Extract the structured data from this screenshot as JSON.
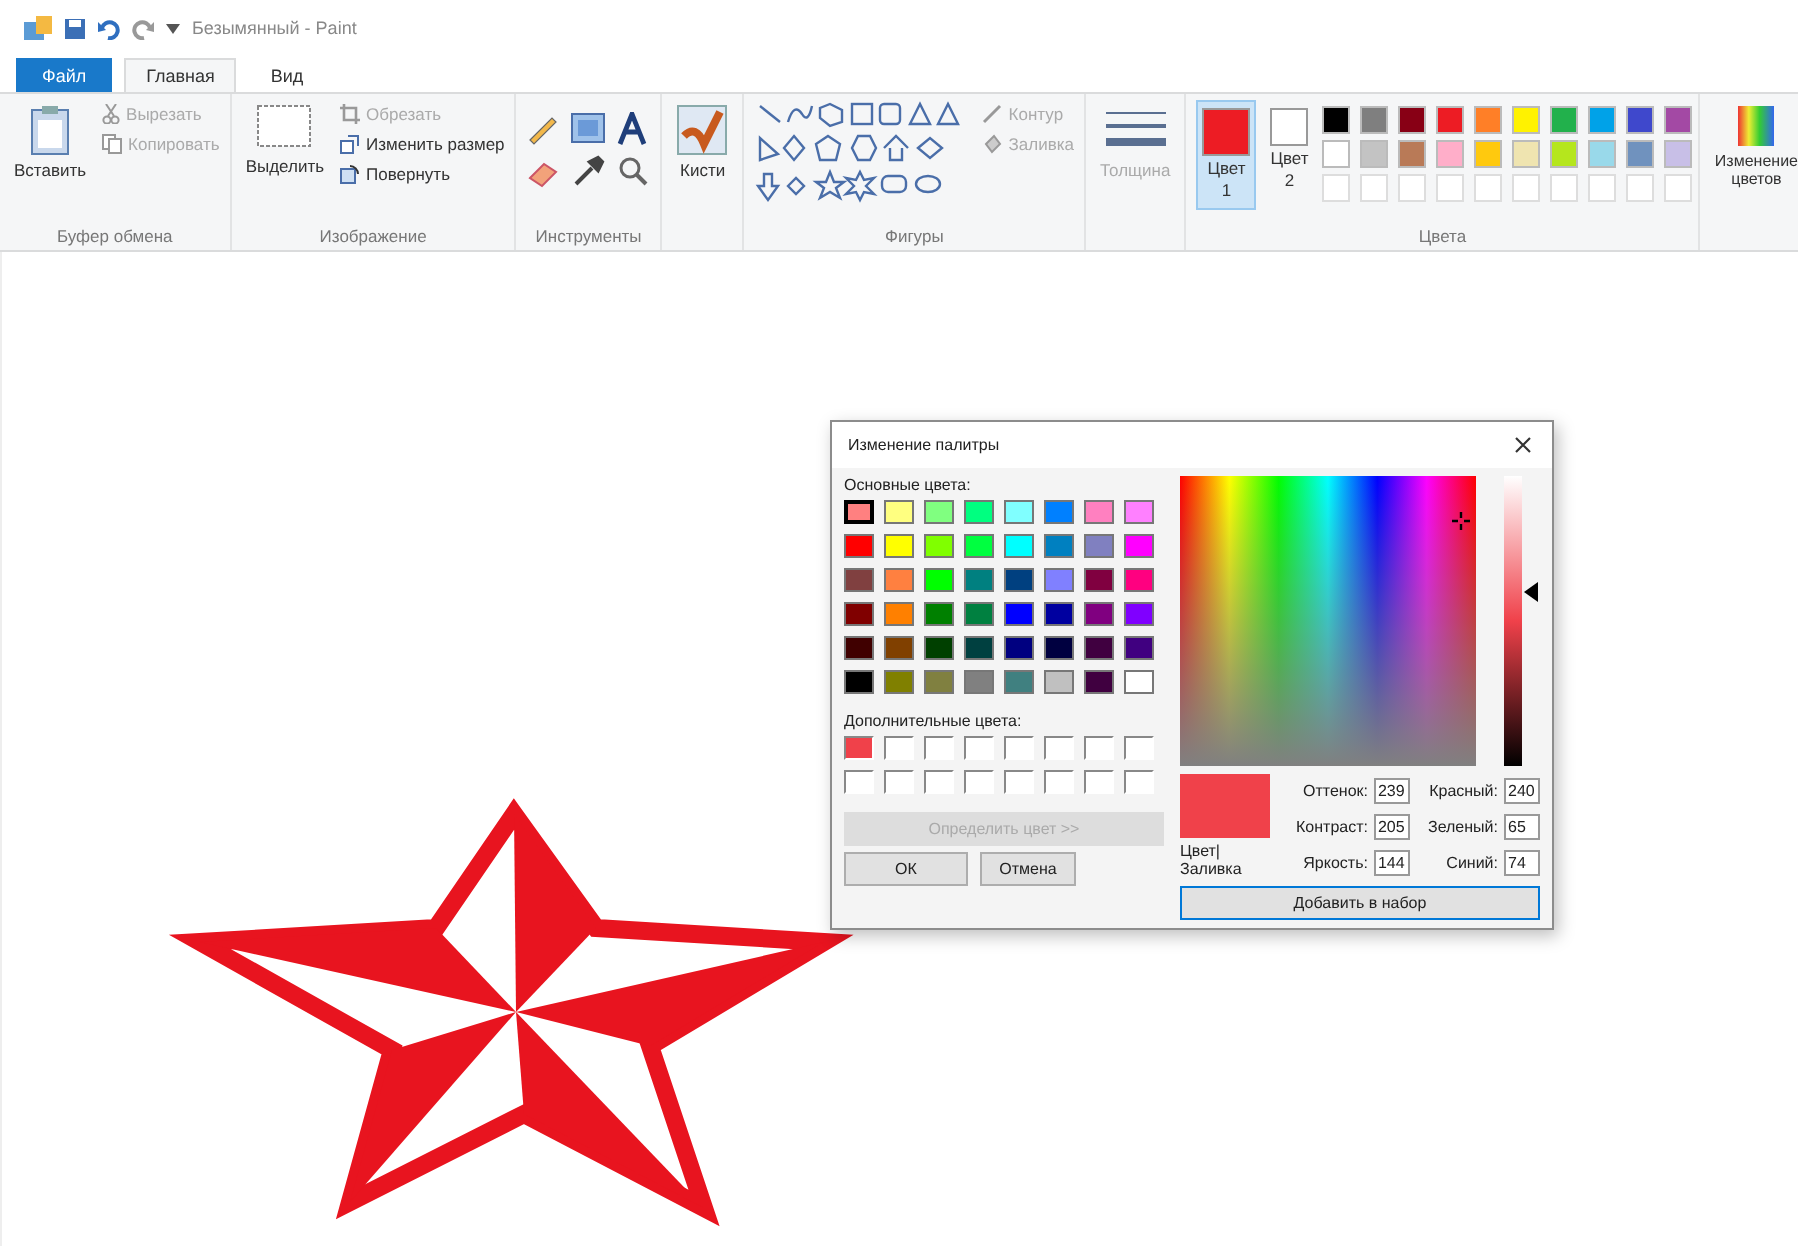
{
  "title_bar": {
    "title": "Безымянный - Paint"
  },
  "tabs": [
    {
      "label": "Файл",
      "kind": "file",
      "selected": false
    },
    {
      "label": "Главная",
      "kind": "tab",
      "selected": true
    },
    {
      "label": "Вид",
      "kind": "tab",
      "selected": false
    }
  ],
  "ribbon": {
    "clipboard": {
      "label": "Буфер обмена",
      "paste": "Вставить",
      "cut": {
        "label": "Вырезать",
        "disabled": true
      },
      "copy": {
        "label": "Копировать",
        "disabled": true
      }
    },
    "image": {
      "label": "Изображение",
      "select": "Выделить",
      "crop": {
        "label": "Обрезать",
        "disabled": true
      },
      "resize": {
        "label": "Изменить размер",
        "disabled": false
      },
      "rotate": {
        "label": "Повернуть",
        "disabled": false
      }
    },
    "tools": {
      "label": "Инструменты"
    },
    "brushes": "Кисти",
    "shapes": {
      "label": "Фигуры",
      "outline": {
        "label": "Контур",
        "disabled": true
      },
      "fill": {
        "label": "Заливка",
        "disabled": true
      }
    },
    "size": {
      "label": "Толщина",
      "disabled": true
    },
    "colors": {
      "label": "Цвета",
      "slots": [
        {
          "label": "Цвет 1",
          "color": "#ed1c24",
          "selected": true
        },
        {
          "label": "Цвет 2",
          "color": "#ffffff",
          "selected": false
        }
      ],
      "palette": [
        {
          "color": "#000000"
        },
        {
          "color": "#7f7f7f"
        },
        {
          "color": "#880015"
        },
        {
          "color": "#ed1c24"
        },
        {
          "color": "#ff7f27"
        },
        {
          "color": "#fff200"
        },
        {
          "color": "#22b14c"
        },
        {
          "color": "#00a2e8"
        },
        {
          "color": "#3f48cc"
        },
        {
          "color": "#a349a4"
        },
        {
          "color": "#ffffff"
        },
        {
          "color": "#c3c3c3"
        },
        {
          "color": "#b97a57"
        },
        {
          "color": "#ffaec9"
        },
        {
          "color": "#ffc90e"
        },
        {
          "color": "#efe4b0"
        },
        {
          "color": "#b5e61d"
        },
        {
          "color": "#99d9ea"
        },
        {
          "color": "#7092be"
        },
        {
          "color": "#c8bfe7"
        }
      ],
      "edit_colors": "Изменение цветов"
    }
  },
  "dialog": {
    "title": "Изменение палитры",
    "basic_label": "Основные цвета:",
    "basic_colors": [
      {
        "color": "#ff8080",
        "selected": true
      },
      {
        "color": "#ffff80",
        "selected": false
      },
      {
        "color": "#80ff80",
        "selected": false
      },
      {
        "color": "#00ff80",
        "selected": false
      },
      {
        "color": "#80ffff",
        "selected": false
      },
      {
        "color": "#0080ff",
        "selected": false
      },
      {
        "color": "#ff80c0",
        "selected": false
      },
      {
        "color": "#ff80ff",
        "selected": false
      },
      {
        "color": "#ff0000",
        "selected": false
      },
      {
        "color": "#ffff00",
        "selected": false
      },
      {
        "color": "#80ff00",
        "selected": false
      },
      {
        "color": "#00ff40",
        "selected": false
      },
      {
        "color": "#00ffff",
        "selected": false
      },
      {
        "color": "#0080c0",
        "selected": false
      },
      {
        "color": "#8080c0",
        "selected": false
      },
      {
        "color": "#ff00ff",
        "selected": false
      },
      {
        "color": "#804040",
        "selected": false
      },
      {
        "color": "#ff8040",
        "selected": false
      },
      {
        "color": "#00ff00",
        "selected": false
      },
      {
        "color": "#008080",
        "selected": false
      },
      {
        "color": "#004080",
        "selected": false
      },
      {
        "color": "#8080ff",
        "selected": false
      },
      {
        "color": "#800040",
        "selected": false
      },
      {
        "color": "#ff0080",
        "selected": false
      },
      {
        "color": "#800000",
        "selected": false
      },
      {
        "color": "#ff8000",
        "selected": false
      },
      {
        "color": "#008000",
        "selected": false
      },
      {
        "color": "#008040",
        "selected": false
      },
      {
        "color": "#0000ff",
        "selected": false
      },
      {
        "color": "#0000a0",
        "selected": false
      },
      {
        "color": "#800080",
        "selected": false
      },
      {
        "color": "#8000ff",
        "selected": false
      },
      {
        "color": "#400000",
        "selected": false
      },
      {
        "color": "#804000",
        "selected": false
      },
      {
        "color": "#004000",
        "selected": false
      },
      {
        "color": "#004040",
        "selected": false
      },
      {
        "color": "#000080",
        "selected": false
      },
      {
        "color": "#000040",
        "selected": false
      },
      {
        "color": "#400040",
        "selected": false
      },
      {
        "color": "#400080",
        "selected": false
      },
      {
        "color": "#000000",
        "selected": false
      },
      {
        "color": "#808000",
        "selected": false
      },
      {
        "color": "#808040",
        "selected": false
      },
      {
        "color": "#808080",
        "selected": false
      },
      {
        "color": "#408080",
        "selected": false
      },
      {
        "color": "#c0c0c0",
        "selected": false
      },
      {
        "color": "#400040",
        "selected": false
      },
      {
        "color": "#ffffff",
        "selected": false
      }
    ],
    "custom_label": "Дополнительные цвета:",
    "custom_colors": [
      {
        "color": "#f0414a",
        "selected": false
      },
      {
        "color": "#ffffff",
        "selected": false
      },
      {
        "color": "#ffffff",
        "selected": false
      },
      {
        "color": "#ffffff",
        "selected": false
      },
      {
        "color": "#ffffff",
        "selected": false
      },
      {
        "color": "#ffffff",
        "selected": false
      },
      {
        "color": "#ffffff",
        "selected": false
      },
      {
        "color": "#ffffff",
        "selected": false
      },
      {
        "color": "#ffffff",
        "selected": false
      },
      {
        "color": "#ffffff",
        "selected": false
      },
      {
        "color": "#ffffff",
        "selected": false
      },
      {
        "color": "#ffffff",
        "selected": false
      },
      {
        "color": "#ffffff",
        "selected": false
      },
      {
        "color": "#ffffff",
        "selected": false
      },
      {
        "color": "#ffffff",
        "selected": false
      },
      {
        "color": "#ffffff",
        "selected": false
      }
    ],
    "define_button": {
      "label": "Определить цвет >>",
      "disabled": true
    },
    "ok": "ОК",
    "cancel": "Отмена",
    "lum_slider": {
      "level": 0.6
    },
    "preview": {
      "color": "#f0414a",
      "label": "Цвет|Заливка"
    },
    "fields": [
      {
        "label": "Оттенок:",
        "value": "239"
      },
      {
        "label": "Красный:",
        "value": "240"
      },
      {
        "label": "Контраст:",
        "value": "205"
      },
      {
        "label": "Зеленый:",
        "value": "65"
      },
      {
        "label": "Яркость:",
        "value": "144"
      },
      {
        "label": "Синий:",
        "value": "74"
      }
    ],
    "add_button": "Добавить в набор"
  }
}
